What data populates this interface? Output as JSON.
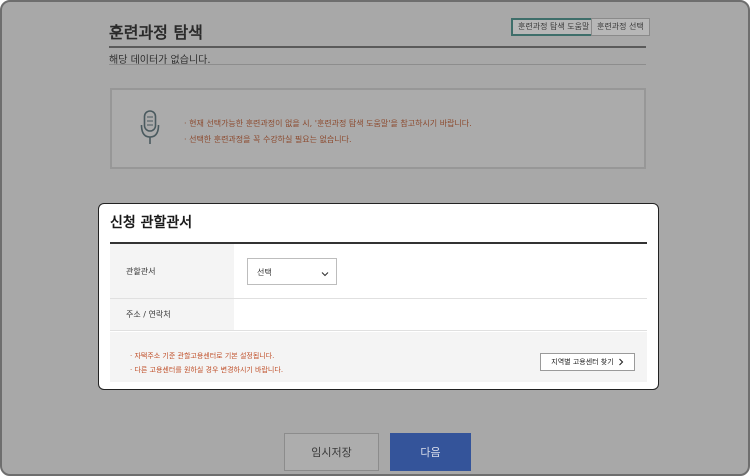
{
  "page": {
    "title": "훈련과정 탐색",
    "header_buttons": [
      "훈련과정 탐색 도움말",
      "훈련과정 선택"
    ],
    "no_data_text": "해당 데이터가 없습니다.",
    "notice": {
      "icon": "microphone-icon",
      "lines": [
        "· 현재 선택가능한 훈련과정이 없을 시, '훈련과정 탐색 도움말'을 참고하시기 바랍니다.",
        "· 선택한 훈련과정을 꼭 수강하실 필요는 없습니다."
      ]
    }
  },
  "modal": {
    "title": "신청 관할관서",
    "rows": {
      "office_label": "관할관서",
      "office_select_value": "선택",
      "address_label": "주소 / 연락처"
    },
    "info_lines": [
      "· 자택주소 기준 관할고용센터로 기본 설정됩니다.",
      "· 다른 고용센터를 원하실 경우 변경하시기 바랍니다."
    ],
    "find_button": "지역별 고용센터 찾기"
  },
  "footer": {
    "save_label": "임시저장",
    "next_label": "다음"
  },
  "colors": {
    "dim_overlay": "#a8a8a8",
    "next_button": "#34549a",
    "notice_text": "#8c4a2e",
    "info_text": "#c0502a"
  }
}
